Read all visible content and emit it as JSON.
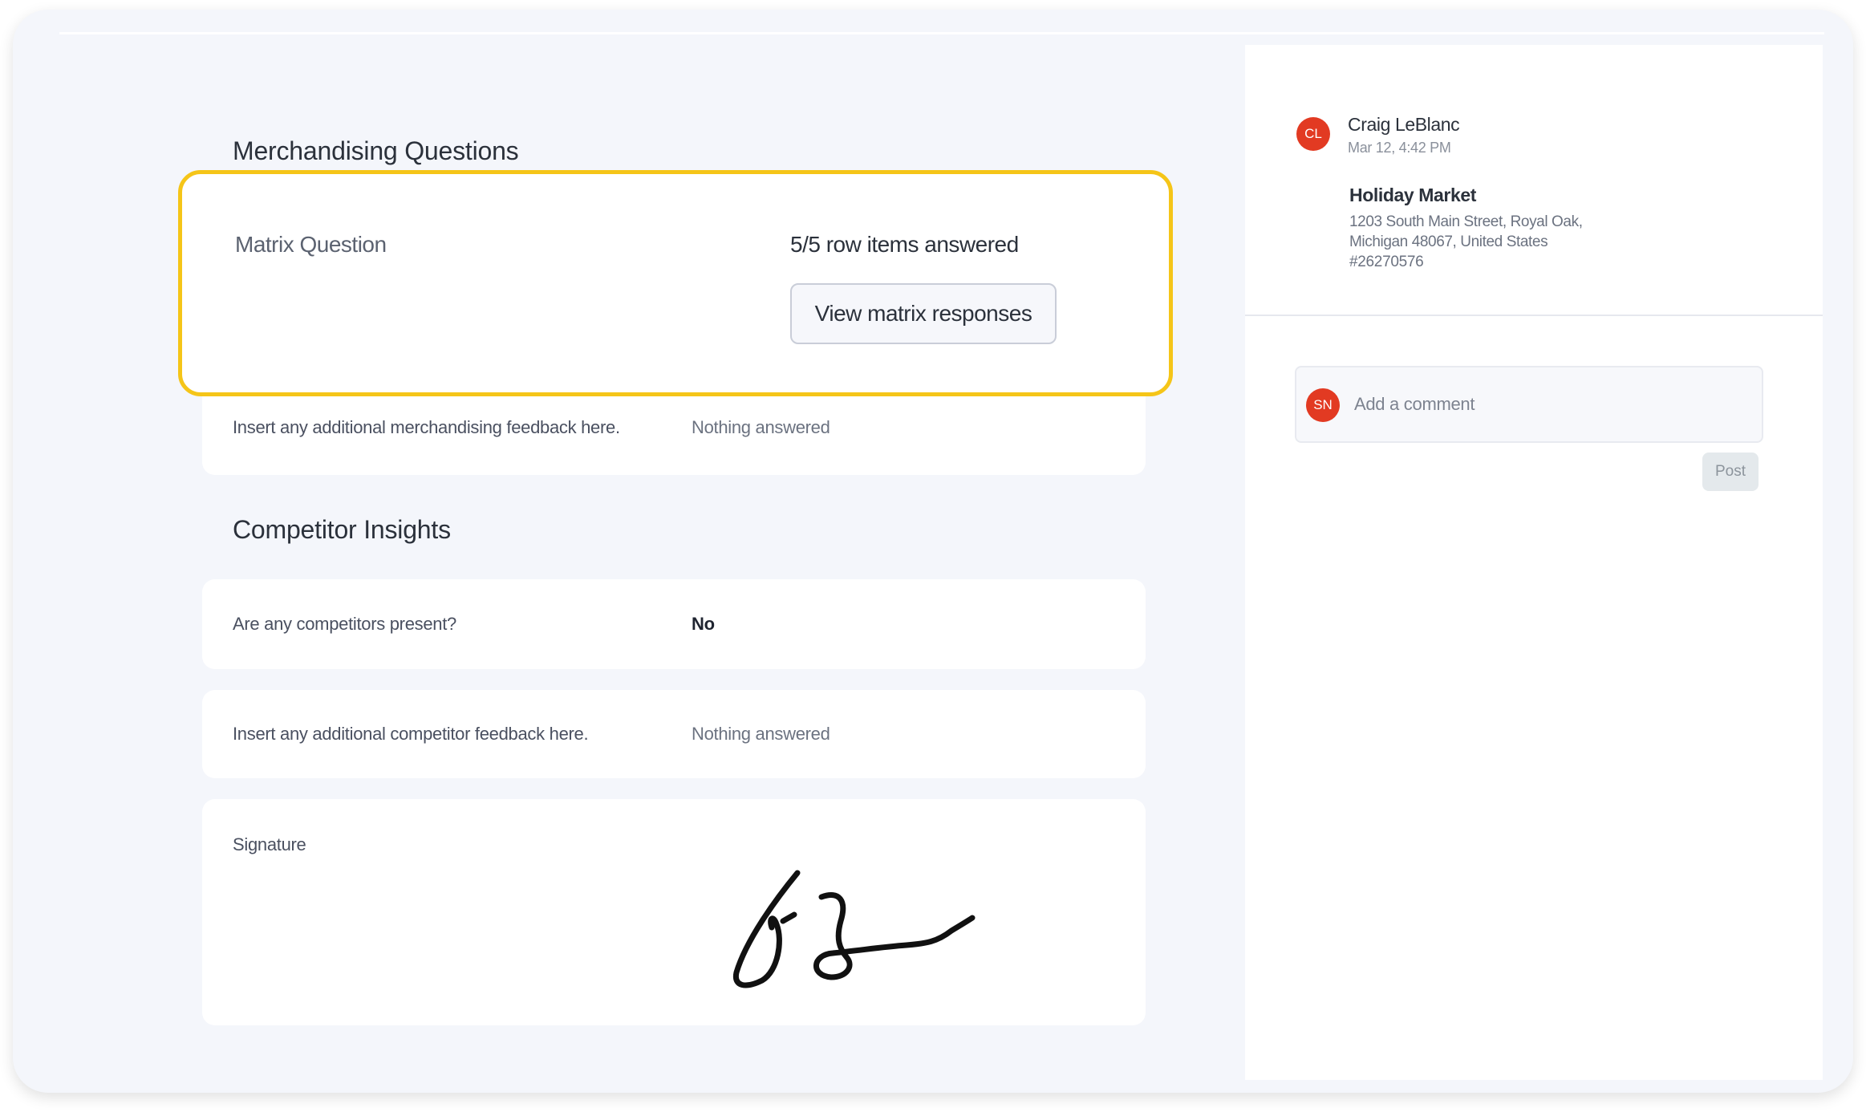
{
  "merchandising": {
    "title": "Merchandising Questions",
    "matrix": {
      "label": "Matrix Question",
      "status": "5/5 row items answered",
      "button_label": "View matrix responses"
    },
    "feedback": {
      "label": "Insert any additional merchandising feedback here.",
      "value": "Nothing answered"
    }
  },
  "competitor": {
    "title": "Competitor Insights",
    "present": {
      "label": "Are any competitors present?",
      "value": "No"
    },
    "feedback": {
      "label": "Insert any additional competitor feedback here.",
      "value": "Nothing answered"
    },
    "signature": {
      "label": "Signature"
    }
  },
  "sidebar": {
    "author": {
      "initials": "CL",
      "name": "Craig LeBlanc",
      "time": "Mar 12, 4:42 PM"
    },
    "store": {
      "name": "Holiday Market",
      "address_line1": "1203 South Main Street, Royal Oak,",
      "address_line2": "Michigan 48067, United States",
      "id": "#26270576"
    },
    "comment": {
      "user_initials": "SN",
      "placeholder": "Add a comment",
      "post_label": "Post"
    }
  },
  "colors": {
    "highlight": "#f5c518",
    "avatar": "#e23a22",
    "background": "#f4f6fb"
  }
}
